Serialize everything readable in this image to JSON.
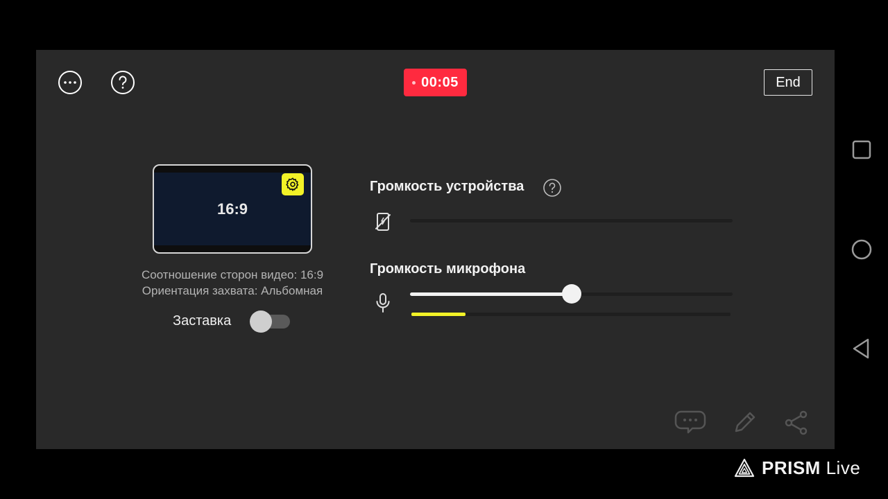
{
  "top_bar": {
    "timer": "00:05",
    "end_label": "End"
  },
  "preview": {
    "ratio_label": "16:9",
    "aspect_text": "Соотношение сторон видео: 16:9",
    "orientation_text": "Ориентация захвата: Альбомная"
  },
  "splash": {
    "label": "Заставка",
    "enabled": false
  },
  "device_volume": {
    "title": "Громкость устройства",
    "level_percent": 0
  },
  "mic_volume": {
    "title": "Громкость микрофона",
    "level_percent": 50,
    "input_meter_percent": 17
  },
  "watermark": {
    "brand_bold": "PRISM",
    "brand_light": "Live"
  },
  "colors": {
    "record_red": "#ff2a3f",
    "accent_yellow": "#f2f227",
    "panel_bg": "#292929"
  }
}
